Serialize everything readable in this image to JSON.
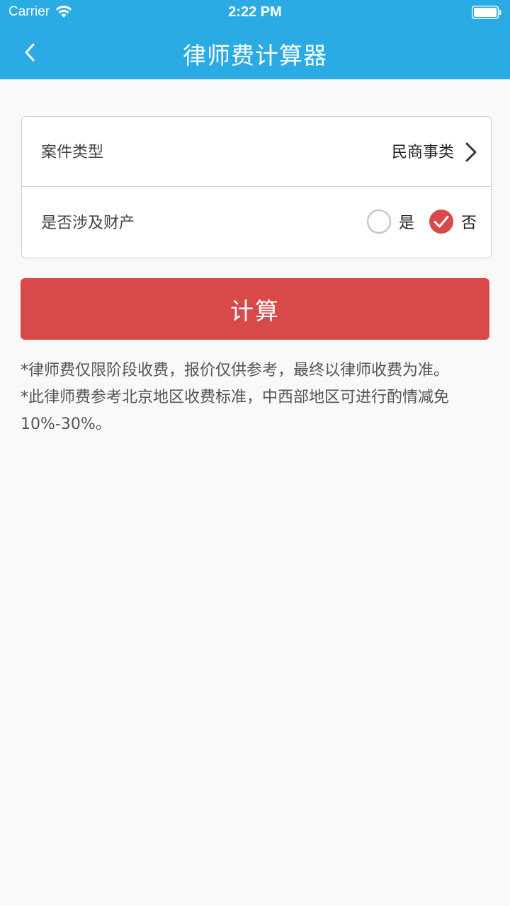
{
  "status_bar": {
    "carrier": "Carrier",
    "time": "2:22 PM"
  },
  "nav": {
    "title": "律师费计算器",
    "back_icon": "chevron-left-icon"
  },
  "form": {
    "case_type": {
      "label": "案件类型",
      "value": "民商事类"
    },
    "property": {
      "label": "是否涉及财产",
      "options": [
        {
          "label": "是",
          "selected": false
        },
        {
          "label": "否",
          "selected": true
        }
      ]
    }
  },
  "calculate_button": {
    "label": "计算"
  },
  "notes": [
    "*律师费仅限阶段收费，报价仅供参考，最终以律师收费为准。",
    "*此律师费参考北京地区收费标准，中西部地区可进行酌情减免10%-30%。"
  ],
  "colors": {
    "header": "#2aabe4",
    "accent": "#d84a49",
    "background": "#f9f9f9"
  }
}
